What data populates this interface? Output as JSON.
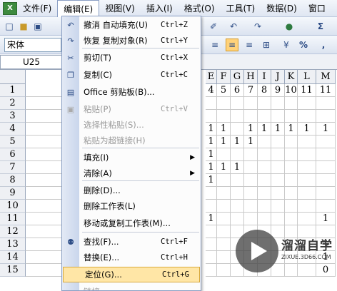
{
  "menubar": {
    "app_icon": "excel-icon",
    "items": [
      {
        "label": "文件(F)",
        "active": false
      },
      {
        "label": "编辑(E)",
        "active": true
      },
      {
        "label": "视图(V)",
        "active": false
      },
      {
        "label": "插入(I)",
        "active": false
      },
      {
        "label": "格式(O)",
        "active": false
      },
      {
        "label": "工具(T)",
        "active": false
      },
      {
        "label": "数据(D)",
        "active": false
      },
      {
        "label": "窗口",
        "active": false
      }
    ]
  },
  "toolbar": {
    "font_name": "宋体",
    "icons": [
      "new-icon",
      "open-icon",
      "save-icon",
      "undo-icon",
      "redo-icon",
      "paint-icon",
      "sigma-icon"
    ]
  },
  "name_box": {
    "value": "U25"
  },
  "grid": {
    "column_headers": [
      "E",
      "F",
      "G",
      "H",
      "I",
      "J",
      "K",
      "L",
      "M"
    ],
    "rows": [
      {
        "num": "1",
        "cells": [
          "4",
          "5",
          "6",
          "7",
          "8",
          "9",
          "10",
          "11",
          "11"
        ]
      },
      {
        "num": "2",
        "cells": [
          "",
          "",
          "",
          "",
          "",
          "",
          "",
          "",
          ""
        ]
      },
      {
        "num": "3",
        "cells": [
          "",
          "",
          "",
          "",
          "",
          "",
          "",
          "",
          ""
        ]
      },
      {
        "num": "4",
        "cells": [
          "1",
          "1",
          "",
          "1",
          "1",
          "1",
          "1",
          "1",
          "1"
        ]
      },
      {
        "num": "5",
        "cells": [
          "1",
          "1",
          "1",
          "1",
          "",
          "",
          "",
          "",
          ""
        ]
      },
      {
        "num": "6",
        "cells": [
          "1",
          "",
          "",
          "",
          "",
          "",
          "",
          "",
          ""
        ]
      },
      {
        "num": "7",
        "cells": [
          "1",
          "1",
          "1",
          "",
          "",
          "",
          "",
          "",
          ""
        ]
      },
      {
        "num": "8",
        "cells": [
          "1",
          "",
          "",
          "",
          "",
          "",
          "",
          "",
          ""
        ]
      },
      {
        "num": "9",
        "cells": [
          "",
          "",
          "",
          "",
          "",
          "",
          "",
          "",
          ""
        ]
      },
      {
        "num": "10",
        "cells": [
          "",
          "",
          "",
          "",
          "",
          "",
          "",
          "",
          ""
        ]
      },
      {
        "num": "11",
        "cells": [
          "1",
          "",
          "",
          "",
          "",
          "",
          "",
          "",
          "1"
        ]
      },
      {
        "num": "12",
        "cells": [
          "",
          "",
          "",
          "",
          "",
          "",
          "",
          "",
          ""
        ]
      },
      {
        "num": "13",
        "cells": [
          "",
          "",
          "",
          "",
          "",
          "",
          "",
          "",
          "1"
        ]
      },
      {
        "num": "14",
        "cells": [
          "",
          "",
          "",
          "",
          "",
          "",
          "",
          "",
          "1"
        ]
      },
      {
        "num": "15",
        "cells": [
          "",
          "",
          "",
          "",
          "",
          "",
          "",
          "",
          "0"
        ]
      }
    ]
  },
  "edit_menu": {
    "items": [
      {
        "icon": "undo-icon",
        "label": "撤消 自动填充(U)",
        "shortcut": "Ctrl+Z",
        "disabled": false
      },
      {
        "icon": "redo-icon",
        "label": "恢复 复制对象(R)",
        "shortcut": "Ctrl+Y",
        "disabled": false
      },
      {
        "icon": "cut-icon",
        "label": "剪切(T)",
        "shortcut": "Ctrl+X",
        "disabled": false
      },
      {
        "icon": "copy-icon",
        "label": "复制(C)",
        "shortcut": "Ctrl+C",
        "disabled": false
      },
      {
        "icon": "clipboard-icon",
        "label": "Office 剪贴板(B)...",
        "shortcut": "",
        "disabled": false
      },
      {
        "icon": "paste-icon",
        "label": "粘贴(P)",
        "shortcut": "Ctrl+V",
        "disabled": true
      },
      {
        "icon": "",
        "label": "选择性粘贴(S)...",
        "shortcut": "",
        "disabled": true
      },
      {
        "icon": "",
        "label": "粘贴为超链接(H)",
        "shortcut": "",
        "disabled": true
      },
      {
        "icon": "",
        "label": "填充(I)",
        "shortcut": "",
        "disabled": false,
        "submenu": true
      },
      {
        "icon": "",
        "label": "清除(A)",
        "shortcut": "",
        "disabled": false,
        "submenu": true
      },
      {
        "icon": "",
        "label": "删除(D)...",
        "shortcut": "",
        "disabled": false
      },
      {
        "icon": "",
        "label": "删除工作表(L)",
        "shortcut": "",
        "disabled": false
      },
      {
        "icon": "",
        "label": "移动或复制工作表(M)...",
        "shortcut": "",
        "disabled": false
      },
      {
        "icon": "binoculars-icon",
        "label": "查找(F)...",
        "shortcut": "Ctrl+F",
        "disabled": false
      },
      {
        "icon": "",
        "label": "替换(E)...",
        "shortcut": "Ctrl+H",
        "disabled": false
      },
      {
        "icon": "",
        "label": "定位(G)...",
        "shortcut": "Ctrl+G",
        "disabled": false,
        "selected": true
      },
      {
        "icon": "",
        "label": "链接",
        "shortcut": "",
        "disabled": true
      }
    ]
  },
  "watermark": {
    "title": "溜溜自学",
    "subtitle": "ZIXUE.3D66.COM"
  }
}
